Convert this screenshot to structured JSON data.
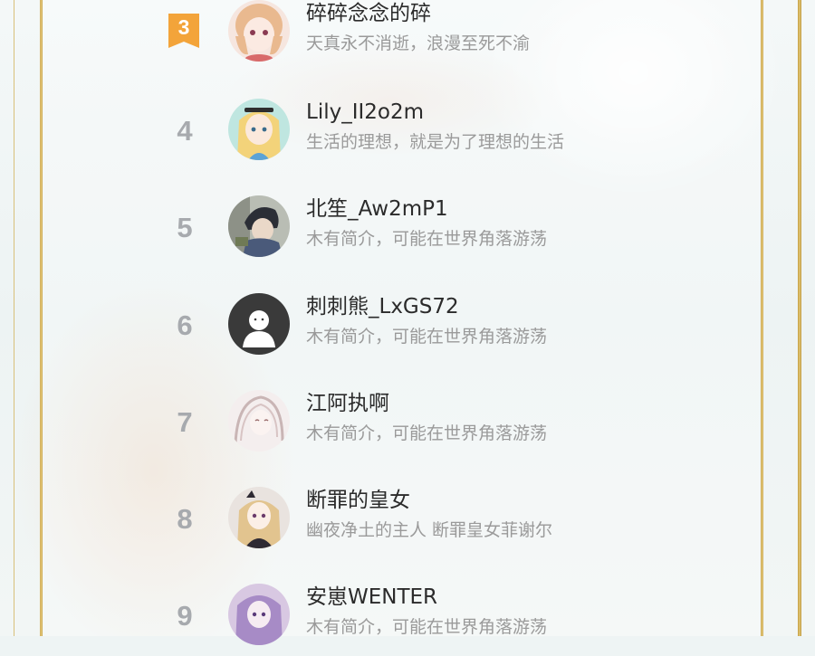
{
  "ranking": {
    "items": [
      {
        "rank": "3",
        "name": "碎碎念念的碎",
        "bio": "天真永不消逝，浪漫至死不渝",
        "avatar_icon": "anime-girl-avatar"
      },
      {
        "rank": "4",
        "name": "Lily_II2o2m",
        "bio": "生活的理想，就是为了理想的生活",
        "avatar_icon": "alice-avatar"
      },
      {
        "rank": "5",
        "name": "北笙_Aw2mP1",
        "bio": "木有简介，可能在世界角落游荡",
        "avatar_icon": "anime-boy-avatar"
      },
      {
        "rank": "6",
        "name": "刺刺熊_LxGS72",
        "bio": "木有简介，可能在世界角落游荡",
        "avatar_icon": "default-user-avatar"
      },
      {
        "rank": "7",
        "name": "江阿执啊",
        "bio": "木有简介，可能在世界角落游荡",
        "avatar_icon": "sketch-girl-avatar"
      },
      {
        "rank": "8",
        "name": "断罪的皇女",
        "bio": "幽夜净土的主人 断罪皇女菲谢尔",
        "avatar_icon": "blonde-girl-avatar"
      },
      {
        "rank": "9",
        "name": "安崽WENTER",
        "bio": "木有简介，可能在世界角落游荡",
        "avatar_icon": "purple-girl-avatar"
      }
    ]
  },
  "colors": {
    "frame_gold": "#c9a24a",
    "rank_badge_orange": "#f3a43a",
    "rank_gray": "#a7aaae",
    "name_text": "#2b2b2b",
    "bio_text": "#9a9a9a"
  }
}
